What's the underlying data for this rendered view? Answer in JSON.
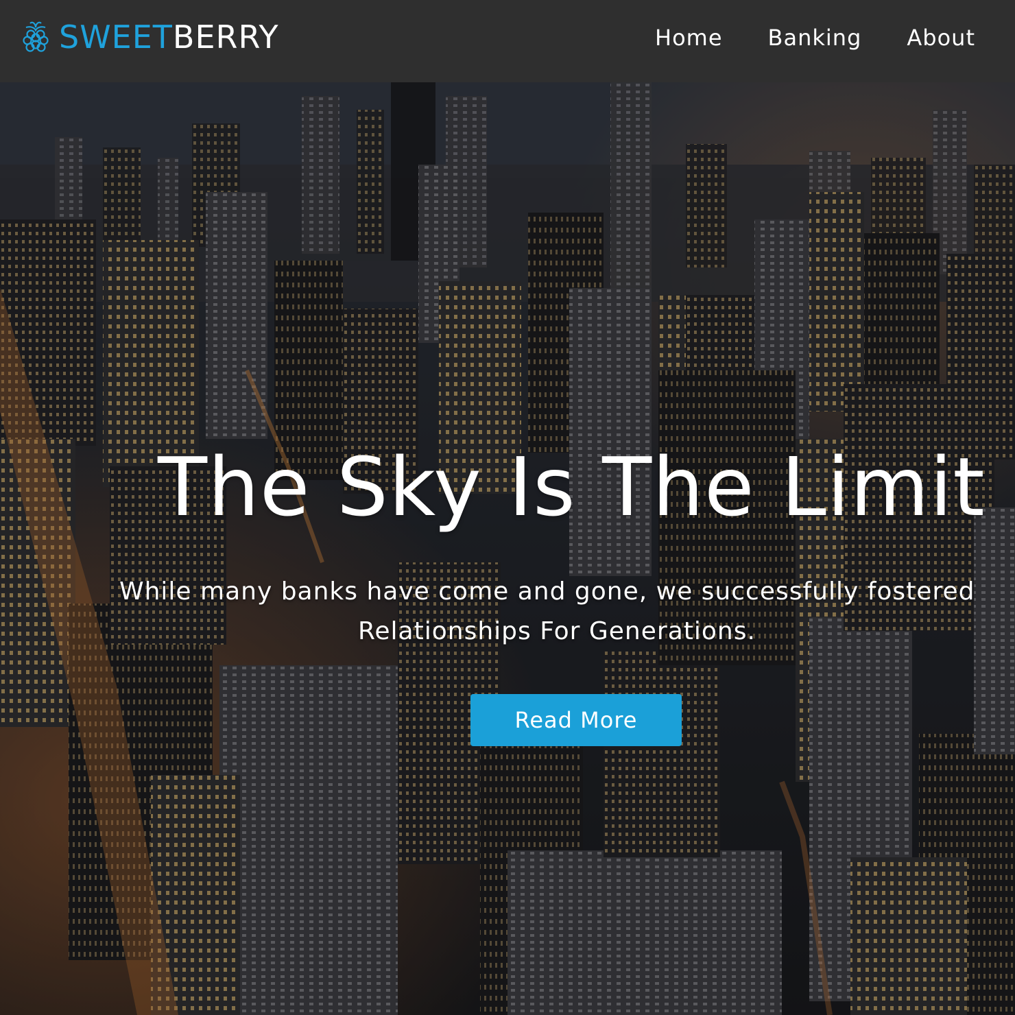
{
  "brand": {
    "name_part1": "SWEET",
    "name_part2": "BERRY",
    "icon": "raspberry-icon",
    "accent_color": "#1fa2dc"
  },
  "nav": {
    "items": [
      {
        "label": "Home"
      },
      {
        "label": "Banking"
      },
      {
        "label": "About"
      }
    ]
  },
  "hero": {
    "background": "night-city-skyline-image",
    "title": "The Sky Is The Limit",
    "subtitle_line1": "While many banks have come and gone, we successfully fostered",
    "subtitle_line2": "Relationships For Generations.",
    "cta_label": "Read More",
    "cta_color": "#1ba0d8"
  }
}
